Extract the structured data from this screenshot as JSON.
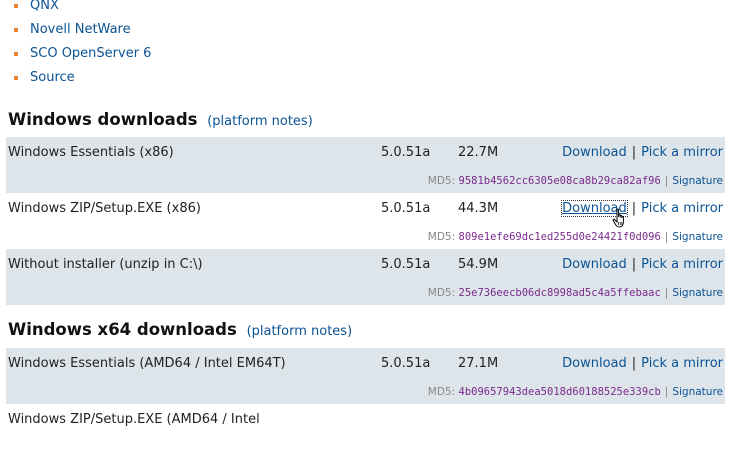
{
  "top_list": [
    "QNX",
    "Novell NetWare",
    "SCO OpenServer 6",
    "Source"
  ],
  "sections": [
    {
      "title": "Windows downloads",
      "notes": "(platform notes)",
      "rows": [
        {
          "name": "Windows Essentials (x86)",
          "version": "5.0.51a",
          "size": "22.7M",
          "download": "Download",
          "sep": "|",
          "mirror": "Pick a mirror",
          "md5_label": "MD5:",
          "md5": "9581b4562cc6305e08ca8b29ca82af96",
          "sig": "Signature"
        },
        {
          "name": "Windows ZIP/Setup.EXE (x86)",
          "version": "5.0.51a",
          "size": "44.3M",
          "download": "Download",
          "sep": "|",
          "mirror": "Pick a mirror",
          "md5_label": "MD5:",
          "md5": "809e1efe69dc1ed255d0e24421f0d096",
          "sig": "Signature"
        },
        {
          "name": "Without installer (unzip in C:\\)",
          "version": "5.0.51a",
          "size": "54.9M",
          "download": "Download",
          "sep": "|",
          "mirror": "Pick a mirror",
          "md5_label": "MD5:",
          "md5": "25e736eecb06dc8998ad5c4a5ffebaac",
          "sig": "Signature"
        }
      ]
    },
    {
      "title": "Windows x64 downloads",
      "notes": "(platform notes)",
      "rows": [
        {
          "name": "Windows Essentials (AMD64 / Intel EM64T)",
          "version": "5.0.51a",
          "size": "27.1M",
          "download": "Download",
          "sep": "|",
          "mirror": "Pick a mirror",
          "md5_label": "MD5:",
          "md5": "4b09657943dea5018d60188525e339cb",
          "sig": "Signature"
        },
        {
          "name": "Windows ZIP/Setup.EXE (AMD64 / Intel"
        }
      ]
    }
  ],
  "colors": {
    "link": "#0b5394",
    "bullet": "#e87722",
    "row_shade": "#dde5ea",
    "md5": "#7a2a8c"
  }
}
